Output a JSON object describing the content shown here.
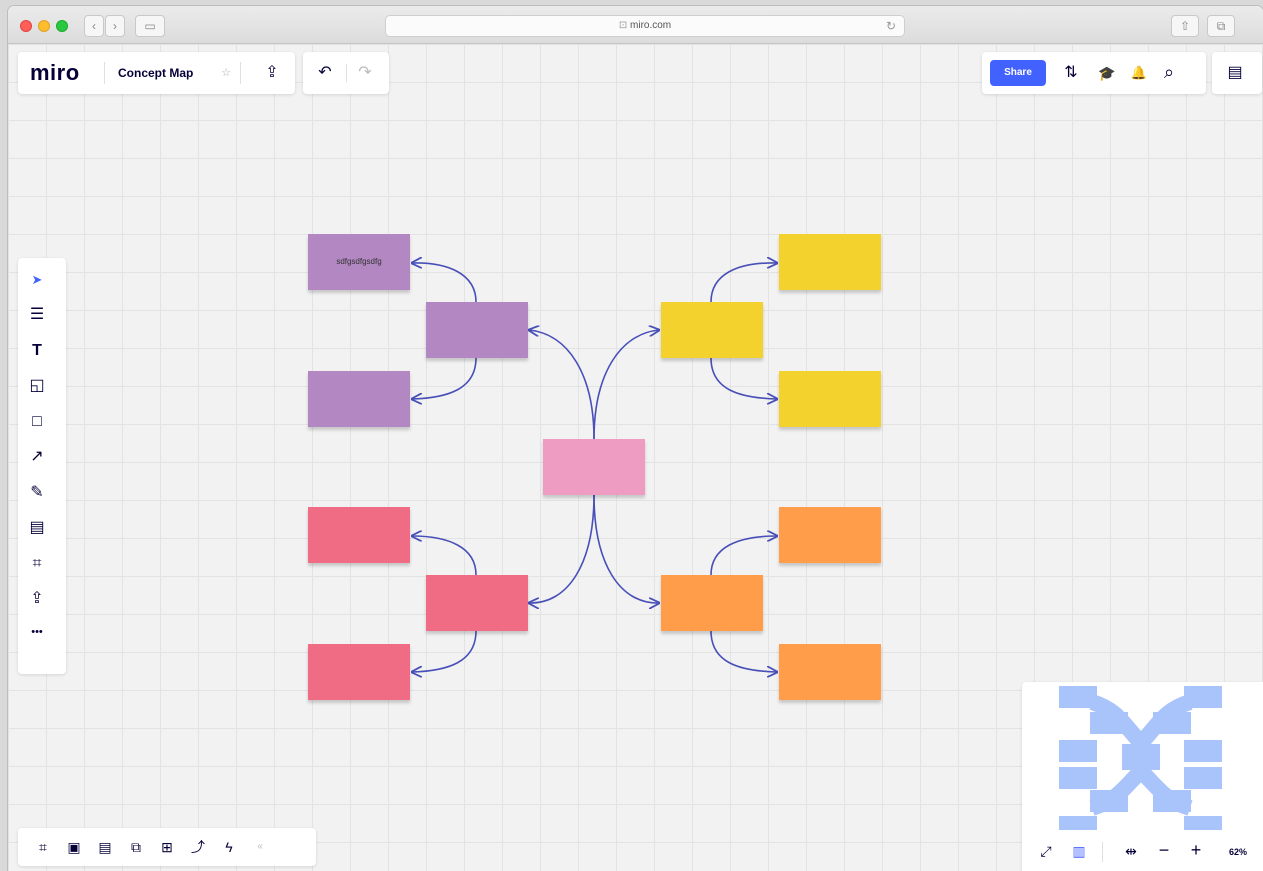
{
  "browser": {
    "url": "miro.com",
    "lock_glyph": "⊡",
    "back_glyph": "‹",
    "forward_glyph": "›",
    "sidebar_glyph": "▭",
    "reload_glyph": "↻",
    "share_glyph": "⇧",
    "tabs_glyph": "⧉"
  },
  "header": {
    "logo": "miro",
    "board_title": "Concept Map",
    "star_glyph": "☆",
    "upload_glyph": "⇪",
    "undo_glyph": "↶",
    "redo_glyph": "↷",
    "share_label": "Share",
    "settings_glyph": "⇅",
    "learn_glyph": "🎓",
    "bell_glyph": "🔔",
    "search_glyph": "⌕",
    "notes_glyph": "▤"
  },
  "toolbar": {
    "tools": [
      {
        "name": "select-tool",
        "glyph": "➤"
      },
      {
        "name": "templates-tool",
        "glyph": "☰"
      },
      {
        "name": "text-tool",
        "glyph": "T"
      },
      {
        "name": "sticky-note-tool",
        "glyph": "◱"
      },
      {
        "name": "shape-tool",
        "glyph": "□"
      },
      {
        "name": "connection-line-tool",
        "glyph": "↗"
      },
      {
        "name": "pen-tool",
        "glyph": "✎"
      },
      {
        "name": "comment-tool",
        "glyph": "▤"
      },
      {
        "name": "frame-tool",
        "glyph": "⌗"
      },
      {
        "name": "upload-tool",
        "glyph": "⇪"
      },
      {
        "name": "more-tools",
        "glyph": "•••"
      }
    ]
  },
  "notes": [
    {
      "id": "center",
      "color": "#ee9cc1",
      "text": ""
    },
    {
      "id": "purple-main",
      "color": "#b287c2",
      "text": ""
    },
    {
      "id": "purple-top",
      "color": "#b287c2",
      "text": "sdfgsdfgsdfg"
    },
    {
      "id": "purple-bottom",
      "color": "#b287c2",
      "text": ""
    },
    {
      "id": "yellow-main",
      "color": "#f4d22e",
      "text": ""
    },
    {
      "id": "yellow-top",
      "color": "#f4d22e",
      "text": ""
    },
    {
      "id": "yellow-bottom",
      "color": "#f4d22e",
      "text": ""
    },
    {
      "id": "red-main",
      "color": "#f06b84",
      "text": ""
    },
    {
      "id": "red-top",
      "color": "#f06b84",
      "text": ""
    },
    {
      "id": "red-bottom",
      "color": "#f06b84",
      "text": ""
    },
    {
      "id": "orange-main",
      "color": "#ff9d4b",
      "text": ""
    },
    {
      "id": "orange-top",
      "color": "#ff9d4b",
      "text": ""
    },
    {
      "id": "orange-bottom",
      "color": "#ff9d4b",
      "text": ""
    }
  ],
  "connector_color": "#4850b8",
  "bottom_bar": {
    "icons": [
      {
        "name": "frames-icon",
        "glyph": "⌗"
      },
      {
        "name": "presentation-icon",
        "glyph": "▣"
      },
      {
        "name": "comments-icon",
        "glyph": "▤"
      },
      {
        "name": "cards-icon",
        "glyph": "⧉"
      },
      {
        "name": "kanban-icon",
        "glyph": "⊞"
      },
      {
        "name": "embed-icon",
        "glyph": "⤴"
      },
      {
        "name": "apps-icon",
        "glyph": "ϟ"
      },
      {
        "name": "collapse-icon",
        "glyph": "«"
      }
    ]
  },
  "minimap": {
    "fill_color": "#a9c4fb",
    "fullscreen_glyph": "⤢",
    "map_glyph": "▥",
    "fit_glyph": "⇹",
    "zoom_out_glyph": "−",
    "zoom_in_glyph": "+",
    "zoom_level": "62%"
  }
}
